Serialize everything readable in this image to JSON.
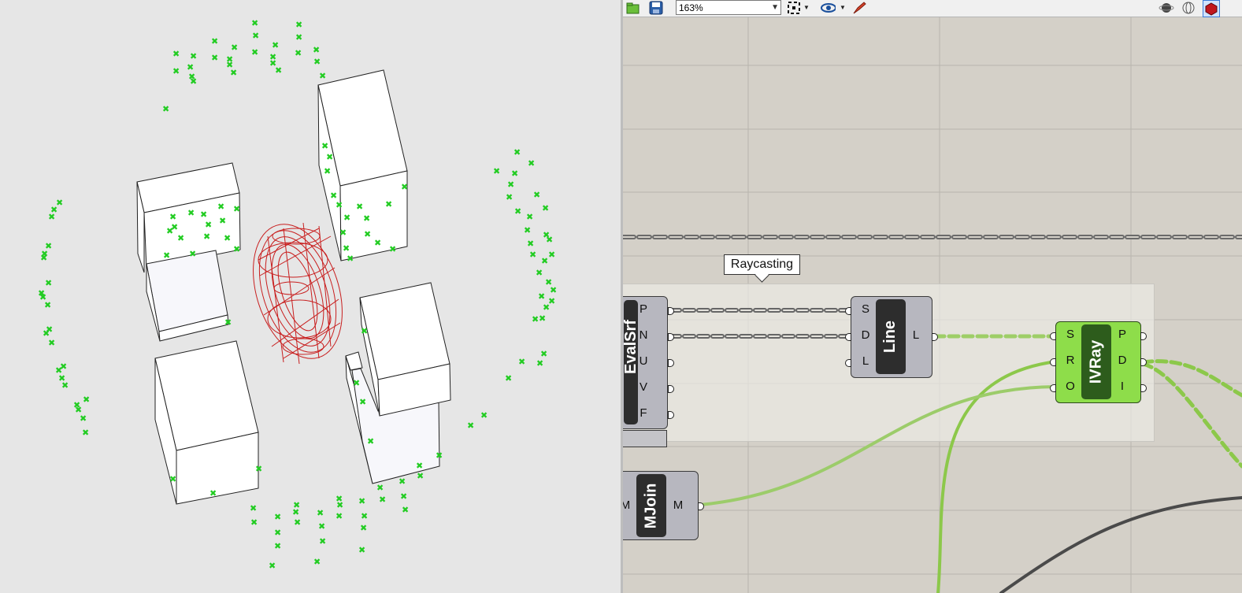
{
  "toolbar": {
    "zoom_value": "163%",
    "icons": [
      "open-file-icon",
      "save-icon",
      "zoom-extents-icon",
      "preview-eye-icon",
      "sketch-pen-icon",
      "preview-shaded-icon",
      "preview-wireframe-icon",
      "preview-selected-icon"
    ]
  },
  "canvas": {
    "group_label": "Raycasting",
    "components": {
      "evalsrf": {
        "label": "EvalSrf",
        "outputs": [
          "P",
          "N",
          "U",
          "V",
          "F"
        ]
      },
      "line": {
        "label": "Line",
        "inputs": [
          "S",
          "D",
          "L"
        ],
        "outputs": [
          "L"
        ]
      },
      "ivray": {
        "label": "IVRay",
        "inputs": [
          "S",
          "R",
          "O"
        ],
        "outputs": [
          "P",
          "D",
          "I"
        ]
      },
      "mjoin": {
        "label": "MJoin",
        "inputs": [
          "M"
        ],
        "outputs": [
          "M"
        ]
      }
    }
  },
  "colors": {
    "viewport_bg": "#e6e6e6",
    "canvas_bg": "#d4d0c8",
    "point_green": "#22cc22",
    "mesh_red": "#c81e1e",
    "active_component": "#8edd4a",
    "wire_green": "#8cc84a",
    "wire_dark": "#4a4a4a"
  }
}
